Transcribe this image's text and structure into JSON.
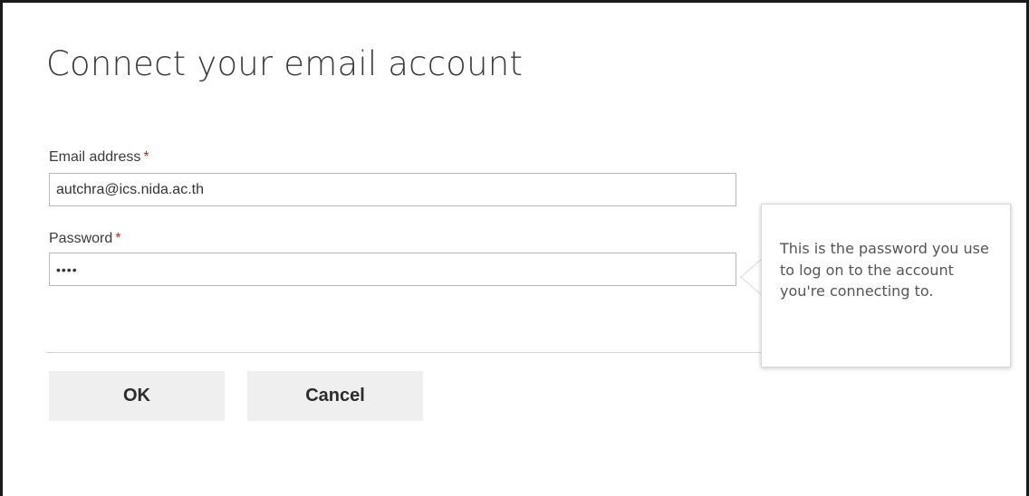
{
  "dialog": {
    "title": "Connect your email account"
  },
  "form": {
    "email": {
      "label": "Email address",
      "required_mark": "*",
      "value": "autchra@ics.nida.ac.th"
    },
    "password": {
      "label": "Password",
      "required_mark": "*",
      "value": "••••"
    }
  },
  "tooltip": {
    "text": "This is the password you use to log on to the account you're connecting to."
  },
  "buttons": {
    "ok_label": "OK",
    "cancel_label": "Cancel"
  },
  "colors": {
    "required": "#c1272d",
    "button_bg": "#efefef",
    "border": "#b8b8b8"
  }
}
